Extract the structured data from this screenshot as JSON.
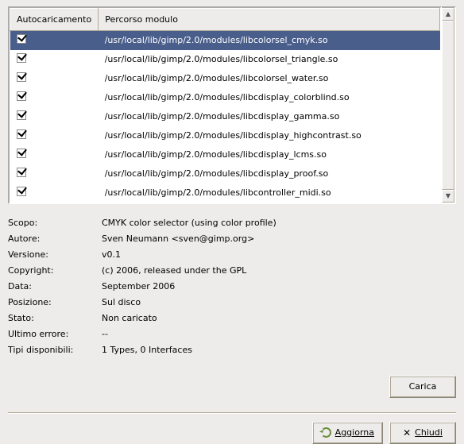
{
  "headers": {
    "auto": "Autocaricamento",
    "path": "Percorso modulo"
  },
  "rows": [
    {
      "checked": true,
      "selected": true,
      "path": "/usr/local/lib/gimp/2.0/modules/libcolorsel_cmyk.so"
    },
    {
      "checked": true,
      "selected": false,
      "path": "/usr/local/lib/gimp/2.0/modules/libcolorsel_triangle.so"
    },
    {
      "checked": true,
      "selected": false,
      "path": "/usr/local/lib/gimp/2.0/modules/libcolorsel_water.so"
    },
    {
      "checked": true,
      "selected": false,
      "path": "/usr/local/lib/gimp/2.0/modules/libcdisplay_colorblind.so"
    },
    {
      "checked": true,
      "selected": false,
      "path": "/usr/local/lib/gimp/2.0/modules/libcdisplay_gamma.so"
    },
    {
      "checked": true,
      "selected": false,
      "path": "/usr/local/lib/gimp/2.0/modules/libcdisplay_highcontrast.so"
    },
    {
      "checked": true,
      "selected": false,
      "path": "/usr/local/lib/gimp/2.0/modules/libcdisplay_lcms.so"
    },
    {
      "checked": true,
      "selected": false,
      "path": "/usr/local/lib/gimp/2.0/modules/libcdisplay_proof.so"
    },
    {
      "checked": true,
      "selected": false,
      "path": "/usr/local/lib/gimp/2.0/modules/libcontroller_midi.so"
    }
  ],
  "labels": {
    "purpose": "Scopo:",
    "author": "Autore:",
    "version": "Versione:",
    "copyright": "Copyright:",
    "date": "Data:",
    "position": "Posizione:",
    "state": "Stato:",
    "last_error": "Ultimo errore:",
    "available_types": "Tipi disponibili:"
  },
  "values": {
    "purpose": "CMYK color selector (using color profile)",
    "author": "Sven Neumann <sven@gimp.org>",
    "version": "v0.1",
    "copyright": "(c) 2006, released under the GPL",
    "date": "September 2006",
    "position": "Sul disco",
    "state": "Non caricato",
    "last_error": "--",
    "available_types": "1 Types, 0 Interfaces"
  },
  "buttons": {
    "load": "Carica",
    "refresh": "Aggiorna",
    "close": "Chiudi"
  }
}
